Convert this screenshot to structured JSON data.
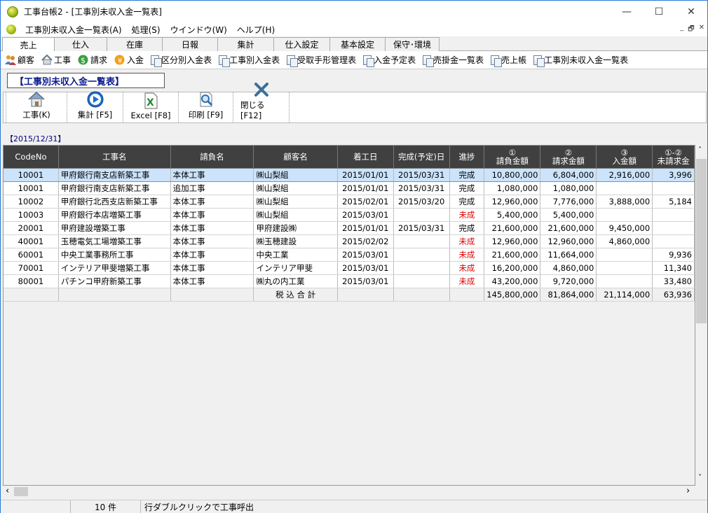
{
  "window": {
    "title": "工事台帳2 - [工事別未収入金一覧表]",
    "minimize": "—",
    "maximize": "☐",
    "close": "✕"
  },
  "menu": [
    "工事別未収入金一覧表(A)",
    "処理(S)",
    "ウインドウ(W)",
    "ヘルプ(H)"
  ],
  "mdi": {
    "min": "_",
    "restore": "🗗",
    "close": "✕"
  },
  "tabs": [
    "売上",
    "仕入",
    "在庫",
    "日報",
    "集計",
    "仕入設定",
    "基本設定",
    "保守･環境"
  ],
  "quickbar": [
    "顧客",
    "工事",
    "請求",
    "入金",
    "区分別入金表",
    "工事別入金表",
    "受取手形管理表",
    "入金予定表",
    "売掛金一覧表",
    "売上帳",
    "工事別未収入金一覧表"
  ],
  "form_title": "【工事別未収入金一覧表】",
  "toolbar": {
    "construction": "工事(K)",
    "aggregate": "集計 [F5]",
    "excel": "Excel [F8]",
    "print": "印刷 [F9]",
    "close": "閉じる [F12]"
  },
  "date_label": "【2015/12/31】",
  "columns": [
    "CodeNo",
    "工事名",
    "請負名",
    "顧客名",
    "着工日",
    "完成(予定)日",
    "進捗",
    "①\n請負金額",
    "②\n請求金額",
    "③\n入金額",
    "①-②\n未請求金"
  ],
  "rows": [
    [
      "10001",
      "甲府銀行南支店新築工事",
      "本体工事",
      "㈱山梨組",
      "2015/01/01",
      "2015/03/31",
      "完成",
      "10,800,000",
      "6,804,000",
      "2,916,000",
      "3,996"
    ],
    [
      "10001",
      "甲府銀行南支店新築工事",
      "追加工事",
      "㈱山梨組",
      "2015/01/01",
      "2015/03/31",
      "完成",
      "1,080,000",
      "1,080,000",
      "",
      ""
    ],
    [
      "10002",
      "甲府銀行北西支店新築工事",
      "本体工事",
      "㈱山梨組",
      "2015/02/01",
      "2015/03/20",
      "完成",
      "12,960,000",
      "7,776,000",
      "3,888,000",
      "5,184"
    ],
    [
      "10003",
      "甲府銀行本店増築工事",
      "本体工事",
      "㈱山梨組",
      "2015/03/01",
      "",
      "未成",
      "5,400,000",
      "5,400,000",
      "",
      ""
    ],
    [
      "20001",
      "甲府建設増築工事",
      "本体工事",
      "甲府建設㈱",
      "2015/01/01",
      "2015/03/31",
      "完成",
      "21,600,000",
      "21,600,000",
      "9,450,000",
      ""
    ],
    [
      "40001",
      "玉穂電気工場増築工事",
      "本体工事",
      "㈱玉穂建設",
      "2015/02/02",
      "",
      "未成",
      "12,960,000",
      "12,960,000",
      "4,860,000",
      ""
    ],
    [
      "60001",
      "中央工業事務所工事",
      "本体工事",
      "中央工業",
      "2015/03/01",
      "",
      "未成",
      "21,600,000",
      "11,664,000",
      "",
      "9,936"
    ],
    [
      "70001",
      "インテリア甲斐増築工事",
      "本体工事",
      "インテリア甲斐",
      "2015/03/01",
      "",
      "未成",
      "16,200,000",
      "4,860,000",
      "",
      "11,340"
    ],
    [
      "80001",
      "パチンコ甲府新築工事",
      "本体工事",
      "㈱丸の内工業",
      "2015/03/01",
      "",
      "未成",
      "43,200,000",
      "9,720,000",
      "",
      "33,480"
    ]
  ],
  "total": {
    "label": "税 込 合 計",
    "contract": "145,800,000",
    "billed": "81,864,000",
    "paid": "21,114,000",
    "unbilled": "63,936"
  },
  "status": {
    "count": "10 件",
    "hint": "行ダブルクリックで工事呼出"
  },
  "scroll": {
    "left": "‹",
    "right": "›",
    "up": "˄",
    "down": "˅"
  },
  "colors": {
    "header": "#404040",
    "selected_row": "#cbe3fb",
    "incomplete": "#e00000",
    "label_blue": "#000080"
  }
}
